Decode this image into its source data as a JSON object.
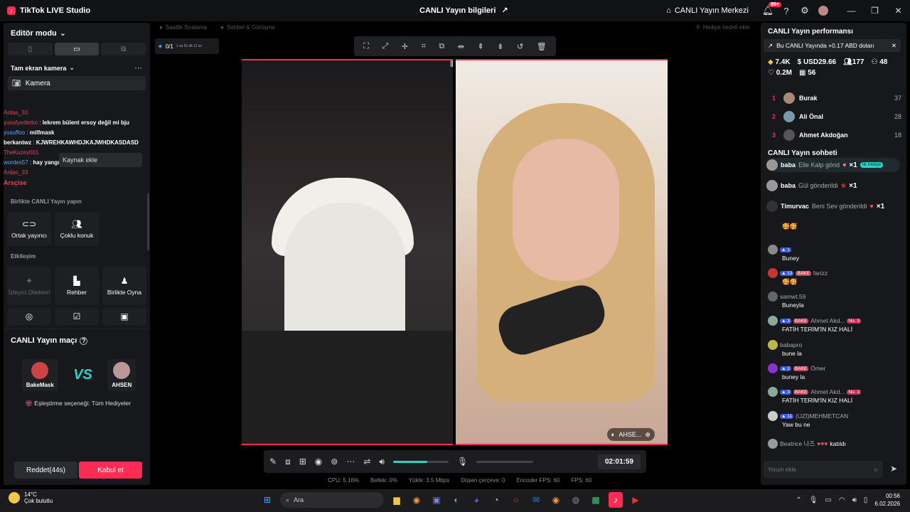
{
  "titlebar": {
    "app_title": "TikTok LIVE Studio",
    "center_title": "CANLI Yayın bilgileri",
    "live_center": "CANLI Yayın Merkezi",
    "notif_badge": "99+"
  },
  "left": {
    "editor_mode": "Editör modu",
    "camera_section": "Tam ekran kamera",
    "camera_item": "Kamera",
    "chat_lines": [
      {
        "user": "Ardas_33",
        "text": ""
      },
      {
        "user": "yusufyederbo",
        "text": "lekrem bülent ersoy değil mi bju"
      },
      {
        "user": "yusuffoo",
        "text": "milfmask"
      },
      {
        "user": "berkantwz",
        "text": "KJWREHKAWHDJKAJWHDKASDASD"
      },
      {
        "user": "TheKuzey001",
        "text": ""
      },
      {
        "user": "wordex57",
        "text": "hay yangını"
      },
      {
        "user": "Ardas_33",
        "text": ""
      }
    ],
    "tooltip": "Kaynak ekle",
    "arsclue": "Arsçise",
    "together_label": "Birlikte CANLI Yayın yapın",
    "tiles_together": [
      {
        "label": "Ortak yayıncı",
        "icon": "link-icon"
      },
      {
        "label": "Çoklu konuk",
        "icon": "users-icon"
      }
    ],
    "interaction_label": "Etkileşim",
    "tiles_interaction": [
      {
        "label": "İzleyici Dilekleri",
        "icon": "wish-icon"
      },
      {
        "label": "Rehber",
        "icon": "guide-icon"
      },
      {
        "label": "Birlikte Oyna",
        "icon": "play-together-icon"
      }
    ],
    "match": {
      "title": "CANLI Yayın maçı",
      "player_a": "BakeMask",
      "player_b": "AHSEN",
      "vs": "VS",
      "setting": "Eşleştirme seçeneği: Tüm Hediyeler",
      "reject": "Reddet(44s)",
      "accept": "Kabul et"
    }
  },
  "center": {
    "scene_tabs": [
      "Saatlik Sıralama",
      "Sohbet & Görüşme",
      "Hediye hedefi ekle"
    ],
    "goal_count": "0/1",
    "goal_time": "1 sa 51 dk 11 sn",
    "guest_name": "AHSE...",
    "timer": "02:01:59",
    "volume_pct": 0.62,
    "stats": [
      "CPU: 5.16%",
      "Bellek: 0%",
      "Yükle: 3.5 Mbps",
      "Düşen çerçeve: 0",
      "Encoder FPS: 60",
      "FPS: 60"
    ]
  },
  "right": {
    "perf_title": "CANLI Yayın performansı",
    "perf_banner": "Bu CANLI Yayında +0.17 ABD doları",
    "stats": [
      "7.4K",
      "USD29.66",
      "177",
      "48",
      "0.2M",
      "56"
    ],
    "ranking": [
      {
        "rank": "1",
        "name": "Burak",
        "score": "37"
      },
      {
        "rank": "2",
        "name": "Ali Önal",
        "score": "28"
      },
      {
        "rank": "3",
        "name": "Ahmet Akdoğan",
        "score": "18"
      }
    ],
    "chat_title": "CANLI Yayın sohbeti",
    "gifts": [
      {
        "user": "baba",
        "text": "Elle Kalp gönd",
        "count": "×1",
        "tag": "İlk Hediye"
      },
      {
        "user": "baba",
        "text": "Gül gönderildi",
        "count": "×1",
        "tag": ""
      },
      {
        "user": "Timurvac",
        "text": "Beni Sev gönderildi",
        "count": "×1",
        "tag": ""
      }
    ],
    "messages": [
      {
        "user": "",
        "level": "",
        "fan": "",
        "body": "🥰🥰"
      },
      {
        "user": "",
        "level": "1",
        "fan": "",
        "body": "Buney"
      },
      {
        "user": "farizz",
        "level": "13",
        "fan": "BAKE",
        "body": "🥰🥰"
      },
      {
        "user": "samwt.59",
        "level": "",
        "fan": "",
        "body": "Buneyla"
      },
      {
        "user": "Ahmet Akd...",
        "level": "3",
        "fan": "BAKE",
        "body": "FATİH TERİM'İN KIZ HALİ",
        "rank": "No. 3"
      },
      {
        "user": "babapro",
        "level": "",
        "fan": "",
        "body": "bune la"
      },
      {
        "user": "Ömer",
        "level": "2",
        "fan": "BAKE",
        "body": "buney la"
      },
      {
        "user": "Ahmet Akd...",
        "level": "3",
        "fan": "BAKE",
        "body": "FATİH TERİM'İN KIZ HALİ",
        "rank": "No. 3"
      },
      {
        "user": "(UZİ)MEHMETCAN",
        "level": "11",
        "fan": "",
        "body": "Yaw bu ne"
      },
      {
        "user": "Beatrice 나즈",
        "level": "",
        "fan": "",
        "body": "katıldı"
      }
    ],
    "comment_placeholder": "Yorum ekle"
  },
  "taskbar": {
    "temp": "14°C",
    "weather": "Çok bulutlu",
    "search": "Ara",
    "time": "00:56",
    "date": "6.02.2026"
  },
  "colors": {
    "accent": "#fe2c55",
    "teal": "#2fd3c6",
    "panel": "#17181b"
  }
}
